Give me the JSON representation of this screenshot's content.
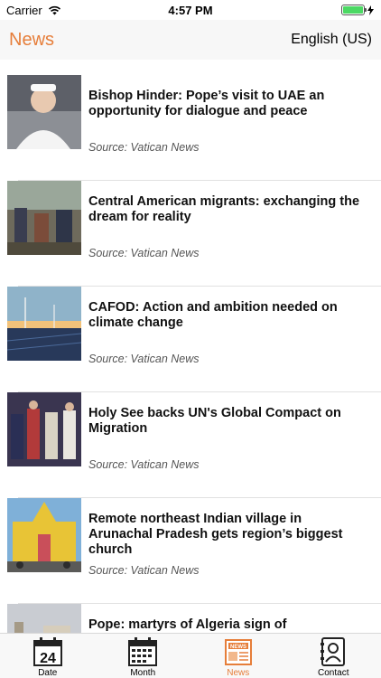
{
  "status_bar": {
    "carrier": "Carrier",
    "time": "4:57 PM"
  },
  "nav": {
    "title": "News",
    "language": "English (US)"
  },
  "news": [
    {
      "title": "Bishop Hinder: Pope’s visit to UAE an opportunity for dialogue and peace",
      "source": "Source: Vatican News"
    },
    {
      "title": "Central American migrants: exchanging the dream for reality",
      "source": "Source: Vatican News"
    },
    {
      "title": "CAFOD: Action and ambition needed on climate change",
      "source": "Source: Vatican News"
    },
    {
      "title": "Holy See backs UN's Global Compact on Migration",
      "source": "Source: Vatican News"
    },
    {
      "title": "Remote northeast Indian village in Arunachal Pradesh gets region’s biggest church",
      "source": "Source: Vatican News"
    },
    {
      "title": "Pope: martyrs of Algeria sign of brotherhood for the world",
      "source": ""
    }
  ],
  "tabs": [
    {
      "label": "Date",
      "icon": "calendar-24-icon",
      "day": "24"
    },
    {
      "label": "Month",
      "icon": "calendar-grid-icon"
    },
    {
      "label": "News",
      "icon": "newspaper-icon",
      "badge": "NEWS"
    },
    {
      "label": "Contact",
      "icon": "contact-book-icon"
    }
  ],
  "colors": {
    "accent": "#e67e3a",
    "battery": "#4cd964"
  }
}
